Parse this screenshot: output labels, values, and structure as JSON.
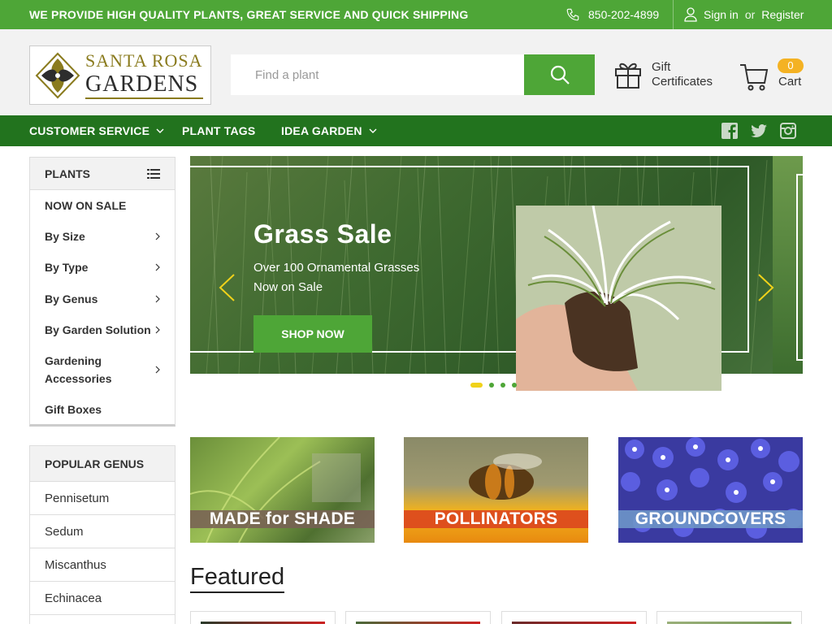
{
  "topbar": {
    "promo": "WE PROVIDE HIGH QUALITY PLANTS, GREAT SERVICE AND QUICK SHIPPING",
    "phone": "850-202-4899",
    "sign_in": "Sign in",
    "or": "or",
    "register": "Register",
    "phone_icon": "phone-icon",
    "user_icon": "user-icon"
  },
  "logo": {
    "line1": "SANTA ROSA",
    "line2": "GARDENS"
  },
  "search": {
    "placeholder": "Find a plant",
    "icon": "search-icon"
  },
  "gift": {
    "line1": "Gift",
    "line2": "Certificates",
    "icon": "gift-icon"
  },
  "cart": {
    "count": "0",
    "label": "Cart",
    "icon": "cart-icon"
  },
  "nav": {
    "items": [
      "CUSTOMER SERVICE",
      "PLANT TAGS",
      "IDEA GARDEN"
    ],
    "social": [
      "facebook-icon",
      "twitter-icon",
      "instagram-icon"
    ]
  },
  "plants_menu": {
    "title": "PLANTS",
    "items": [
      "NOW ON SALE",
      "By Size",
      "By Type",
      "By Genus",
      "By Garden Solution",
      "Gardening Accessories",
      "Gift Boxes"
    ]
  },
  "popular_genus": {
    "title": "POPULAR GENUS",
    "items": [
      "Pennisetum",
      "Sedum",
      "Miscanthus",
      "Echinacea"
    ]
  },
  "hero": {
    "title": "Grass Sale",
    "subtitle": "Over 100 Ornamental Grasses Now on Sale",
    "button": "SHOP NOW",
    "slide_count": 4,
    "active_slide": 1
  },
  "tiles": [
    "MADE for SHADE",
    "POLLINATORS",
    "GROUNDCOVERS"
  ],
  "featured_title": "Featured",
  "colors": {
    "brand_green": "#4ea637",
    "nav_green": "#22731e",
    "header_bg": "#f2f2f2",
    "cart_badge": "#f4b223",
    "active_dot": "#f0d21a"
  }
}
